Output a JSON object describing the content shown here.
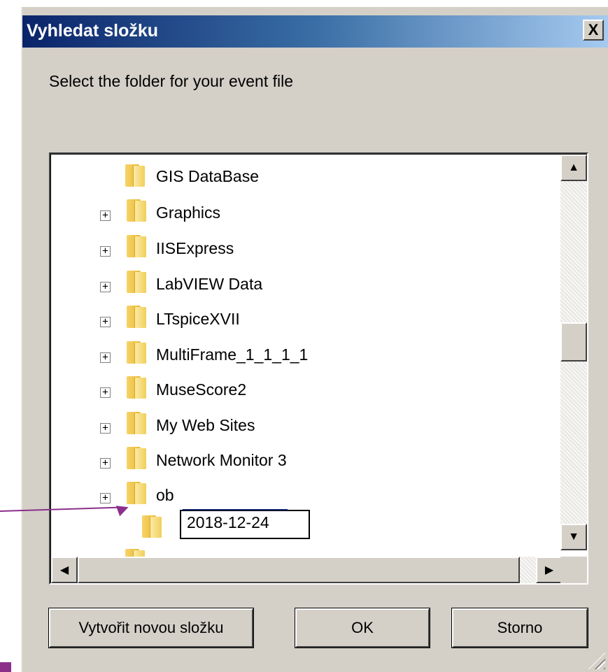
{
  "dialog": {
    "title": "Vyhledat složku",
    "close_label": "X",
    "prompt": "Select the folder for your event file"
  },
  "tree": {
    "items": [
      {
        "label": "GIS DataBase",
        "expandable": false
      },
      {
        "label": "Graphics",
        "expandable": true
      },
      {
        "label": "IISExpress",
        "expandable": true
      },
      {
        "label": "LabVIEW Data",
        "expandable": true
      },
      {
        "label": "LTspiceXVII",
        "expandable": true
      },
      {
        "label": "MultiFrame_1_1_1_1",
        "expandable": true
      },
      {
        "label": "MuseScore2",
        "expandable": true
      },
      {
        "label": "My Web Sites",
        "expandable": true
      },
      {
        "label": "Network Monitor 3",
        "expandable": true
      },
      {
        "label": "ob",
        "expandable": true
      }
    ],
    "expander_symbol": "+",
    "editing_item": {
      "value": "2018-12-24"
    }
  },
  "scrollbar": {
    "up_icon": "▲",
    "down_icon": "▼",
    "left_icon": "◀",
    "right_icon": "▶"
  },
  "buttons": {
    "new_folder": "Vytvořit novou složku",
    "ok": "OK",
    "cancel": "Storno"
  },
  "colors": {
    "title_bar": "#0a246a",
    "dialog_bg": "#d4d0c8",
    "annotation_arrow": "#8b2f8b"
  }
}
